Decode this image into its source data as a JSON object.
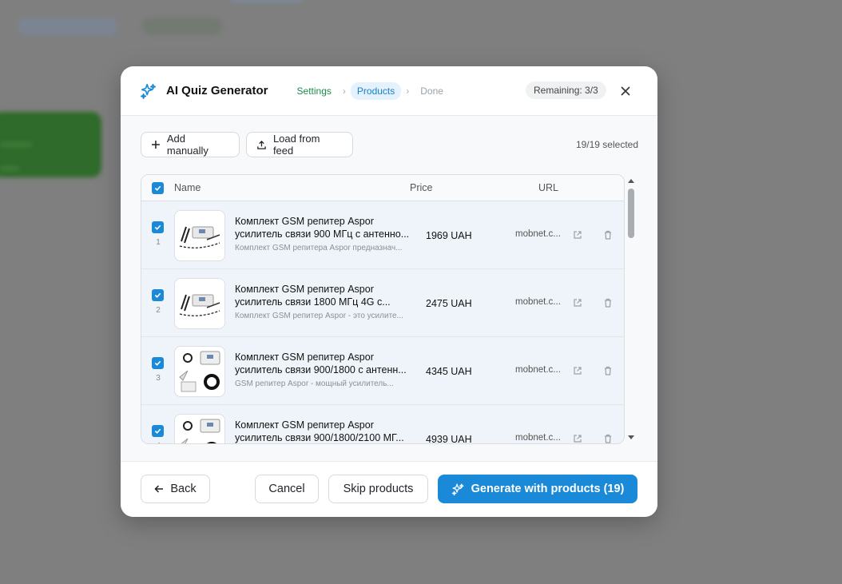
{
  "modal": {
    "title": "AI Quiz Generator",
    "steps": [
      "Settings",
      "Products",
      "Done"
    ],
    "active_step": "Products",
    "remaining": "Remaining: 3/3"
  },
  "toolbar": {
    "add_manually": "Add manually",
    "load_from_feed": "Load from feed",
    "selected": "19/19 selected"
  },
  "table": {
    "headers": {
      "name": "Name",
      "price": "Price",
      "url": "URL"
    },
    "rows": [
      {
        "num": "1",
        "title_line1": "Комплект GSM репитер Aspor",
        "title_line2": "усилитель связи 900 МГц с антенно...",
        "description": "Комплект GSM репитера Aspor предназнач...",
        "price": "1969 UAH",
        "url": "mobnet.c...",
        "image": "repeater-antenna-kit"
      },
      {
        "num": "2",
        "title_line1": "Комплект GSM репитер Aspor",
        "title_line2": "усилитель связи 1800 МГц 4G с...",
        "description": "Комплект GSM репитер Aspor - это усилите...",
        "price": "2475 UAH",
        "url": "mobnet.c...",
        "image": "repeater-antenna-kit"
      },
      {
        "num": "3",
        "title_line1": "Комплект GSM репитер Aspor",
        "title_line2": "усилитель связи 900/1800 с антенн...",
        "description": "GSM репитер Aspor - мощный усилитель...",
        "price": "4345 UAH",
        "url": "mobnet.c...",
        "image": "repeater-cable-kit"
      },
      {
        "num": "4",
        "title_line1": "Комплект GSM репитер Aspor",
        "title_line2": "усилитель связи 900/1800/2100 МГ...",
        "description": "",
        "price": "4939 UAH",
        "url": "mobnet.c...",
        "image": "repeater-cable-kit"
      }
    ]
  },
  "footer": {
    "back": "Back",
    "cancel": "Cancel",
    "skip": "Skip products",
    "generate": "Generate with products (19)"
  },
  "colors": {
    "accent": "#1a8ad8",
    "step_done": "#1e8a4d",
    "backdrop": "#7f7f7f"
  },
  "icons": [
    "sparkles-icon",
    "close-icon",
    "plus-icon",
    "upload-icon",
    "check-icon",
    "external-link-icon",
    "trash-icon",
    "arrow-left-icon"
  ]
}
